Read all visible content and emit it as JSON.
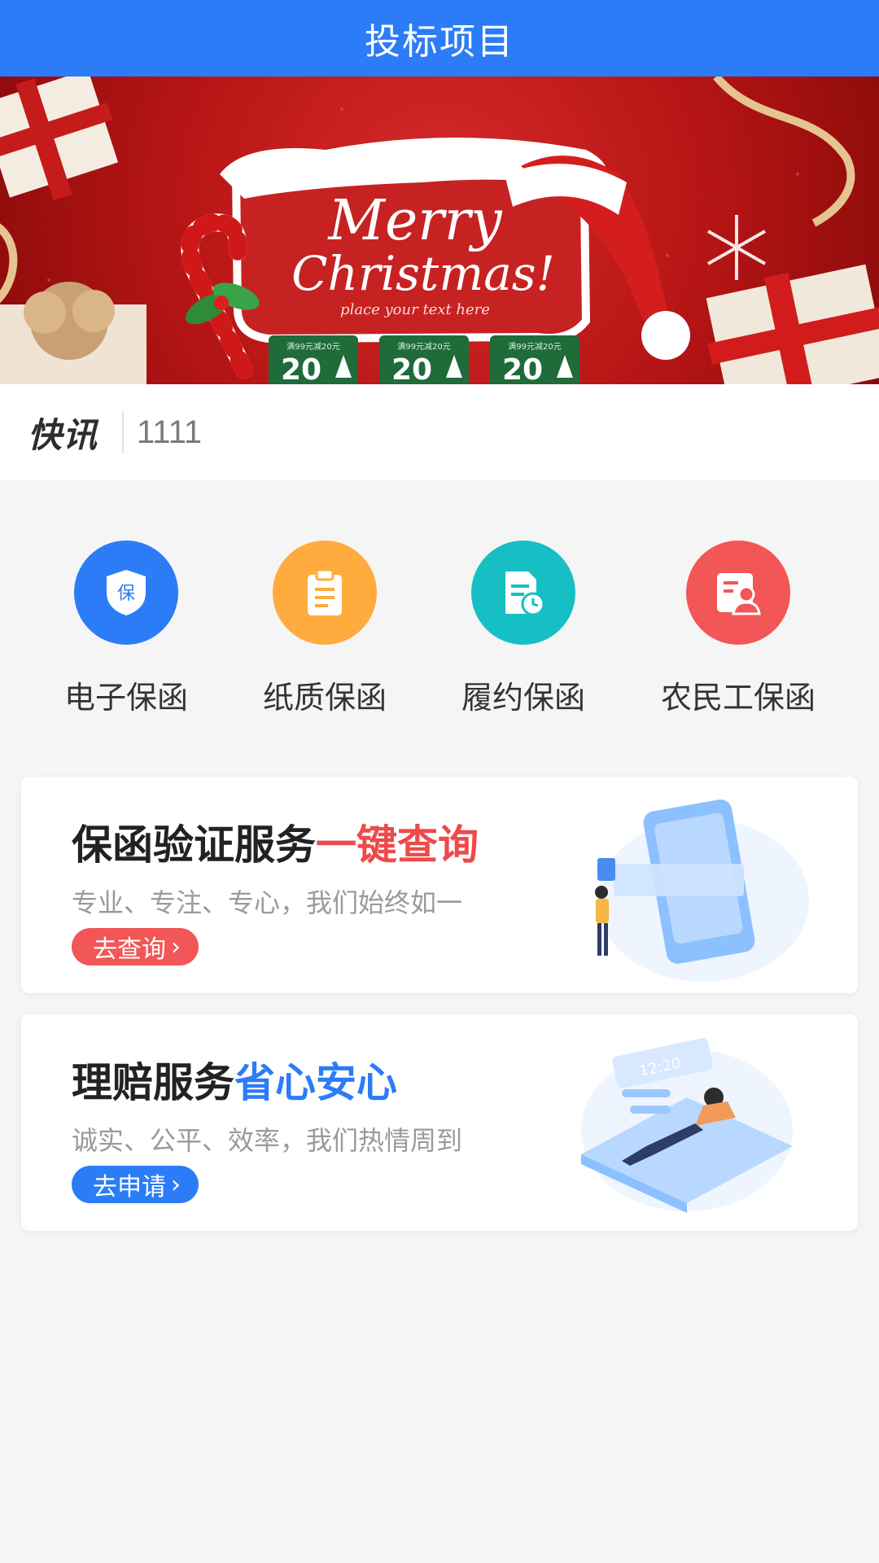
{
  "header": {
    "title": "投标项目"
  },
  "banner": {
    "headline_1": "Merry",
    "headline_2": "Christmas!",
    "tagline": "place your text here",
    "coupons": [
      {
        "caption": "满99元减20元",
        "value": "20"
      },
      {
        "caption": "满99元减20元",
        "value": "20"
      },
      {
        "caption": "满99元减20元",
        "value": "20"
      }
    ]
  },
  "news": {
    "tag": "快讯",
    "text": "1111"
  },
  "quick_links": [
    {
      "label": "电子保函",
      "icon": "shield-icon",
      "color": "#2b7cf6",
      "glyph": "保"
    },
    {
      "label": "纸质保函",
      "icon": "clipboard-icon",
      "color": "#ffab3d"
    },
    {
      "label": "履约保函",
      "icon": "document-clock-icon",
      "color": "#16bfc4"
    },
    {
      "label": "农民工保函",
      "icon": "id-card-user-icon",
      "color": "#f25656"
    }
  ],
  "cards": [
    {
      "title_main": "保函验证服务",
      "title_highlight": "一键查询",
      "subtitle": "专业、专注、专心，我们始终如一",
      "button_label": "去查询",
      "button_color": "#f25656",
      "highlight_color": "#ee4a4a"
    },
    {
      "title_main": "理赔服务",
      "title_highlight": "省心安心",
      "subtitle": "诚实、公平、效率，我们热情周到",
      "button_label": "去申请",
      "button_color": "#2b7cf6",
      "highlight_color": "#2b7cf6",
      "art_text": "12:20"
    }
  ]
}
